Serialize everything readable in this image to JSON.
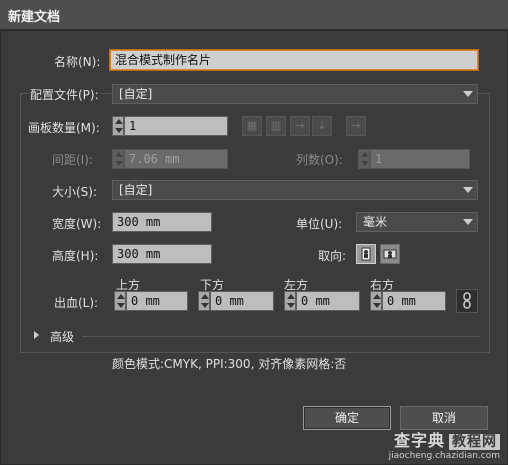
{
  "window": {
    "title": "新建文档"
  },
  "name": {
    "label": "名称(N):",
    "value": "混合模式制作名片"
  },
  "profile": {
    "label": "配置文件(P):",
    "value": "[自定]"
  },
  "artboards": {
    "count_label": "画板数量(M):",
    "count_value": "1",
    "spacing_label": "间距(I):",
    "spacing_value": "7.06 mm",
    "columns_label": "列数(O):",
    "columns_value": "1",
    "layout_icons": [
      "grid-by-row-icon",
      "grid-by-column-icon",
      "arrange-by-row-icon",
      "arrange-by-column-icon"
    ],
    "direction_icon": "right-to-left-layout-icon"
  },
  "size": {
    "label": "大小(S):",
    "value": "[自定]"
  },
  "width": {
    "label": "宽度(W):",
    "value": "300 mm"
  },
  "height": {
    "label": "高度(H):",
    "value": "300 mm"
  },
  "units": {
    "label": "单位(U):",
    "value": "毫米"
  },
  "orientation": {
    "label": "取向:",
    "options": [
      "portrait-icon",
      "landscape-icon"
    ],
    "selected": "portrait"
  },
  "bleed": {
    "label": "出血(L):",
    "top_label": "上方",
    "top_value": "0 mm",
    "bottom_label": "下方",
    "bottom_value": "0 mm",
    "left_label": "左方",
    "left_value": "0 mm",
    "right_label": "右方",
    "right_value": "0 mm",
    "link_icon": "chain-link-icon"
  },
  "advanced": {
    "label": "高级"
  },
  "summary": "颜色模式:CMYK, PPI:300, 对齐像素网格:否",
  "buttons": {
    "ok": "确定",
    "cancel": "取消"
  },
  "watermark": {
    "line1": "查字典",
    "line1_tag": "教程网",
    "line2": "jiaocheng.chazidian.com"
  },
  "colors": {
    "background": "#3b3b3b",
    "focus_border": "#e08a2a",
    "field_bg": "#bdbdbd"
  }
}
